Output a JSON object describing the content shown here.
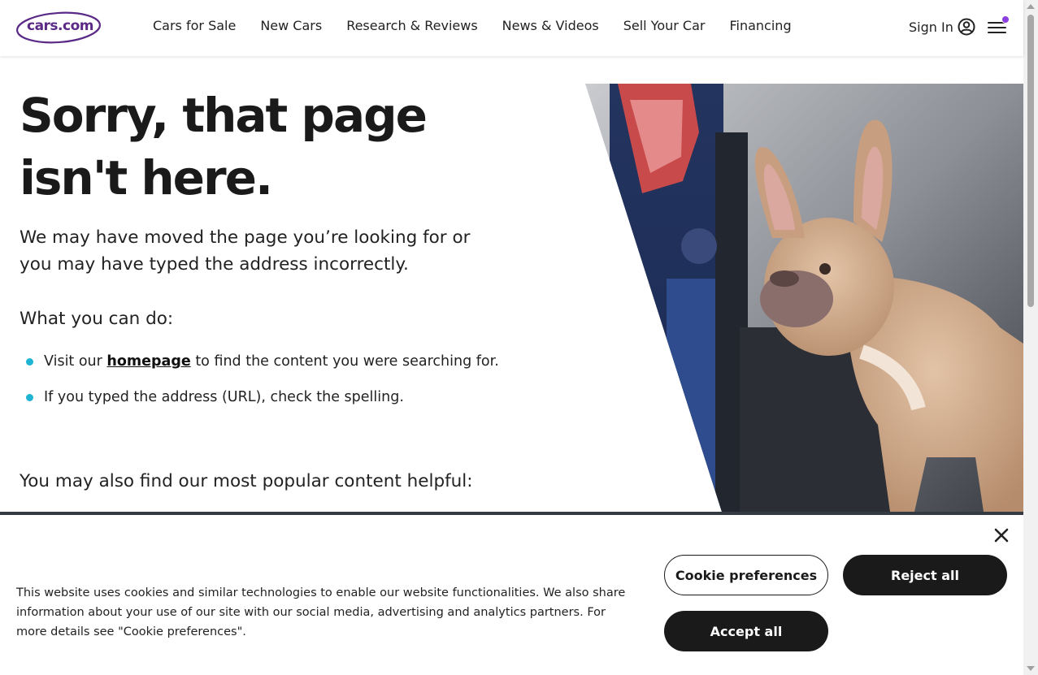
{
  "header": {
    "logo_text": "cars.com",
    "nav": [
      "Cars for Sale",
      "New Cars",
      "Research & Reviews",
      "News & Videos",
      "Sell Your Car",
      "Financing"
    ],
    "sign_in": "Sign In"
  },
  "main": {
    "title_line1": "Sorry, that page",
    "title_line2": "isn't here.",
    "intro": "We may have moved the page you’re looking for or you may have typed the address incorrectly.",
    "subhead": "What you can do:",
    "tip1_before": "Visit our ",
    "tip1_link": "homepage",
    "tip1_after": " to find the content you were searching for.",
    "tip2": "If you typed the address (URL), check the spelling.",
    "popular": "You may also find our most popular content helpful:"
  },
  "cookie": {
    "text": "This website uses cookies and similar technologies to enable our website functionalities. We also share information about your use of our site with our social media, advertising and analytics partners. For more details see \"Cookie preferences\".",
    "preferences_label": "Cookie preferences",
    "reject_label": "Reject all",
    "accept_label": "Accept all"
  },
  "icons": {
    "user": "user-circle-icon",
    "menu": "hamburger-menu-icon",
    "close": "close-icon"
  },
  "colors": {
    "brand": "#5b2a86",
    "bullet": "#1fb3d4",
    "notification_dot": "#8c3ee0",
    "dark_button": "#1a1a1a"
  }
}
